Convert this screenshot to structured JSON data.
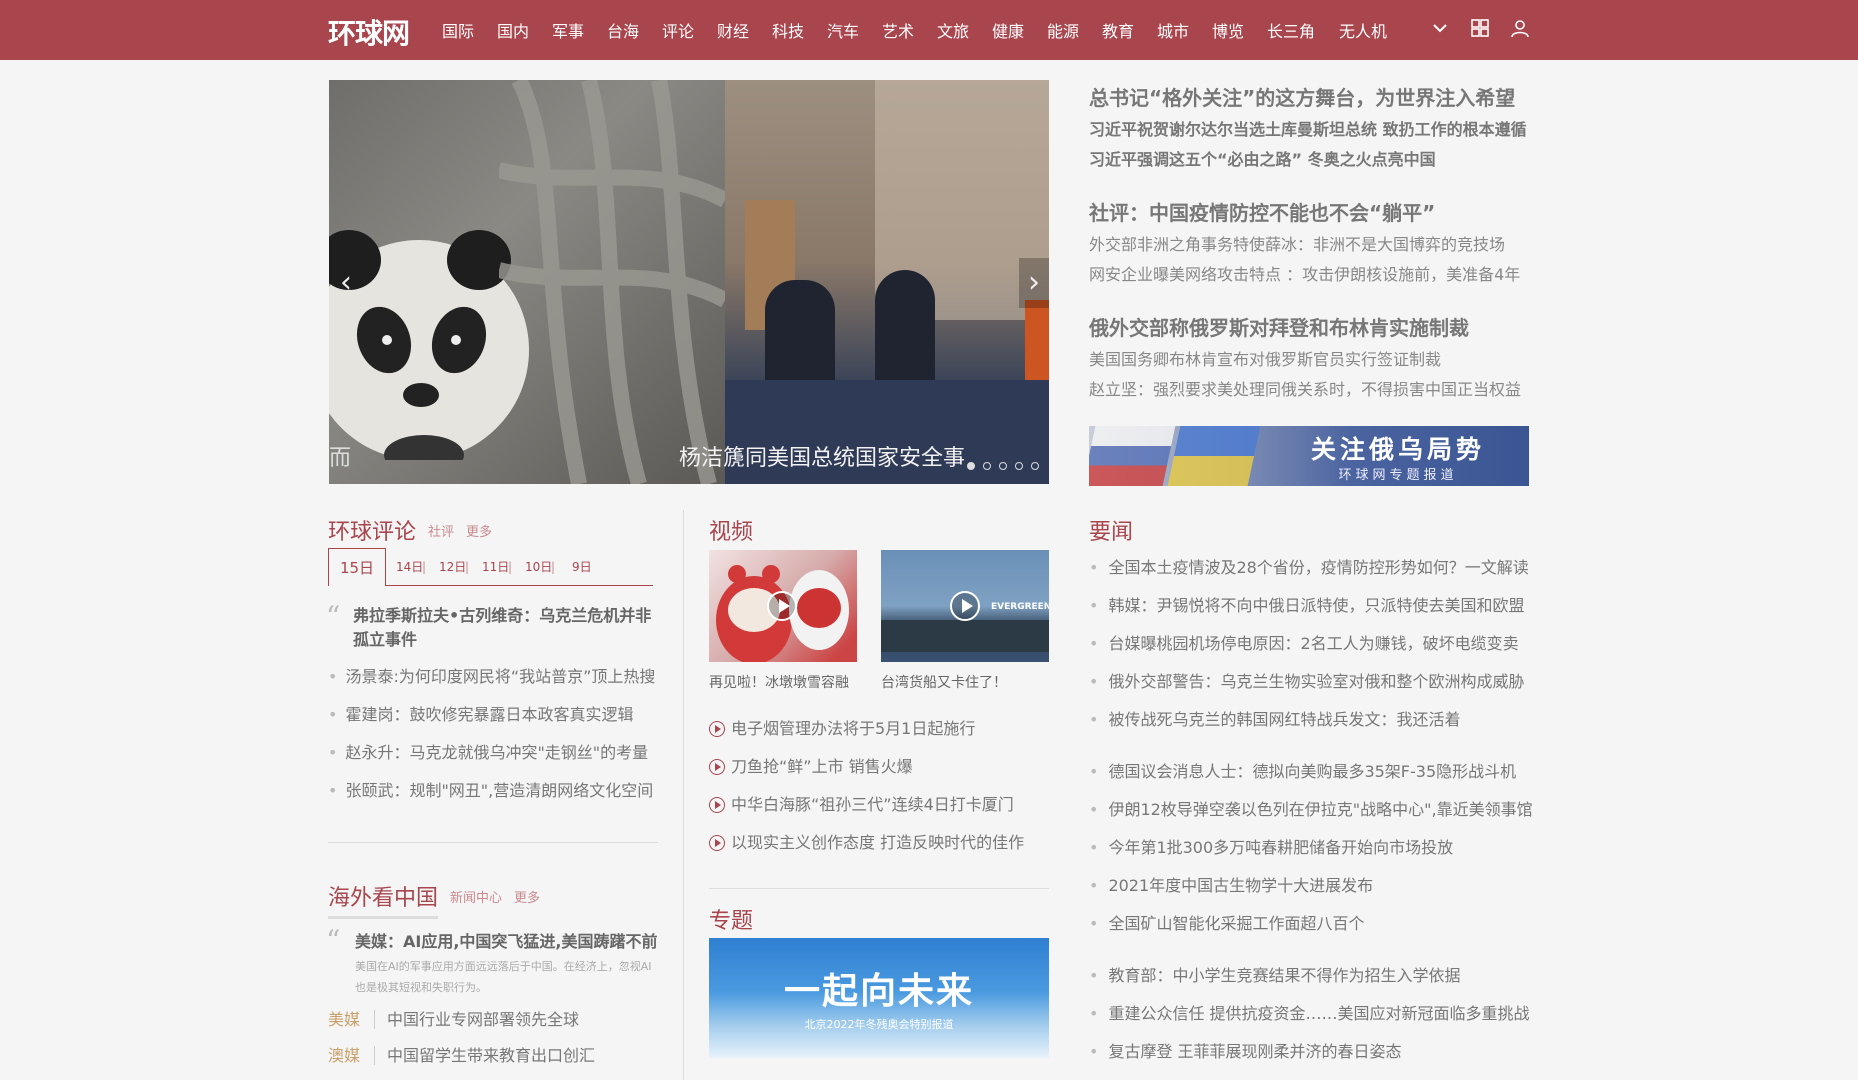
{
  "header": {
    "logo": "环球网",
    "nav": [
      "国际",
      "国内",
      "军事",
      "台海",
      "评论",
      "财经",
      "科技",
      "汽车",
      "艺术",
      "文旅",
      "健康",
      "能源",
      "教育",
      "城市",
      "博览",
      "长三角",
      "无人机"
    ]
  },
  "carousel": {
    "caption": "杨洁篪同美国总统国家安全事",
    "caption_left": "而"
  },
  "headlines": [
    {
      "title": "总书记“格外关注”的这方舞台，为世界注入希望",
      "subs": [
        "习近平祝贺谢尔达尔当选土库曼斯坦总统 致扔工作的根本遵循",
        "习近平强调这五个“必由之路” 冬奥之火点亮中国"
      ],
      "bold_subs": true
    },
    {
      "title": "社评：中国疫情防控不能也不会“躺平”",
      "subs": [
        "外交部非洲之角事务特使薛冰：非洲不是大国博弈的竞技场",
        "网安企业曝美网络攻击特点 ：攻击伊朗核设施前，美准备4年"
      ],
      "bold_subs": false
    },
    {
      "title": "俄外交部称俄罗斯对拜登和布林肯实施制裁",
      "subs": [
        "美国国务卿布林肯宣布对俄罗斯官员实行签证制裁",
        "赵立坚：强烈要求美处理同俄关系时，不得损害中国正当权益"
      ],
      "bold_subs": false
    }
  ],
  "banner": {
    "title": "关注俄乌局势",
    "sub": "环球网专题报道"
  },
  "commentary": {
    "title": "环球评论",
    "links": [
      "社评",
      "更多"
    ],
    "dates": [
      "15日",
      "14日",
      "12日",
      "11日",
      "10日",
      "9日"
    ],
    "featured": "弗拉季斯拉夫•古列维奇：乌克兰危机并非孤立事件",
    "items": [
      "汤景泰:为何印度网民将“我站普京”顶上热搜",
      "霍建岗：鼓吹修宪暴露日本政客真实逻辑",
      "赵永升：马克龙就俄乌冲突\"走钢丝\"的考量",
      "张颐武：规制\"网丑\",营造清朗网络文化空间"
    ]
  },
  "video": {
    "title": "视频",
    "thumbs": [
      {
        "caption": "再见啦！冰墩墩雪容融"
      },
      {
        "caption": "台湾货船又卡住了！",
        "ship_text": "EVERGREEN"
      }
    ],
    "items": [
      "电子烟管理办法将于5月1日起施行",
      "刀鱼抢“鲜”上市 销售火爆",
      "中华白海豚“祖孙三代”连续4日打卡厦门",
      "以现实主义创作态度 打造反映时代的佳作"
    ]
  },
  "special": {
    "title": "专题",
    "banner_title": "一起向未来",
    "banner_sub": "北京2022年冬残奥会特别报道"
  },
  "overseas": {
    "title": "海外看中国",
    "links": [
      "新闻中心",
      "更多"
    ],
    "featured": "美媒：AI应用,中国突飞猛进,美国踌躇不前",
    "desc": "美国在AI的军事应用方面远远落后于中国。在经济上，忽视AI也是极其短视和失职行为。",
    "rows": [
      {
        "tag": "美媒",
        "text": "中国行业专网部署领先全球"
      },
      {
        "tag": "澳媒",
        "text": "中国留学生带来教育出口创汇"
      }
    ]
  },
  "news": {
    "title": "要闻",
    "groups": [
      [
        "全国本土疫情波及28个省份，疫情防控形势如何？一文解读",
        "韩媒：尹锡悦将不向中俄日派特使，只派特使去美国和欧盟",
        "台媒曝桃园机场停电原因：2名工人为赚钱，破坏电缆变卖",
        "俄外交部警告：乌克兰生物实验室对俄和整个欧洲构成威胁",
        "被传战死乌克兰的韩国网红特战兵发文：我还活着"
      ],
      [
        "德国议会消息人士：德拟向美购最多35架F-35隐形战斗机",
        "伊朗12枚导弹空袭以色列在伊拉克\"战略中心\",靠近美领事馆",
        "今年第1批300多万吨春耕肥储备开始向市场投放",
        "2021年度中国古生物学十大进展发布",
        "全国矿山智能化采掘工作面超八百个"
      ],
      [
        "教育部：中小学生竞赛结果不得作为招生入学依据",
        "重建公众信任 提供抗疫资金……美国应对新冠面临多重挑战",
        "复古摩登 王菲菲展现刚柔并济的春日姿态"
      ]
    ]
  }
}
